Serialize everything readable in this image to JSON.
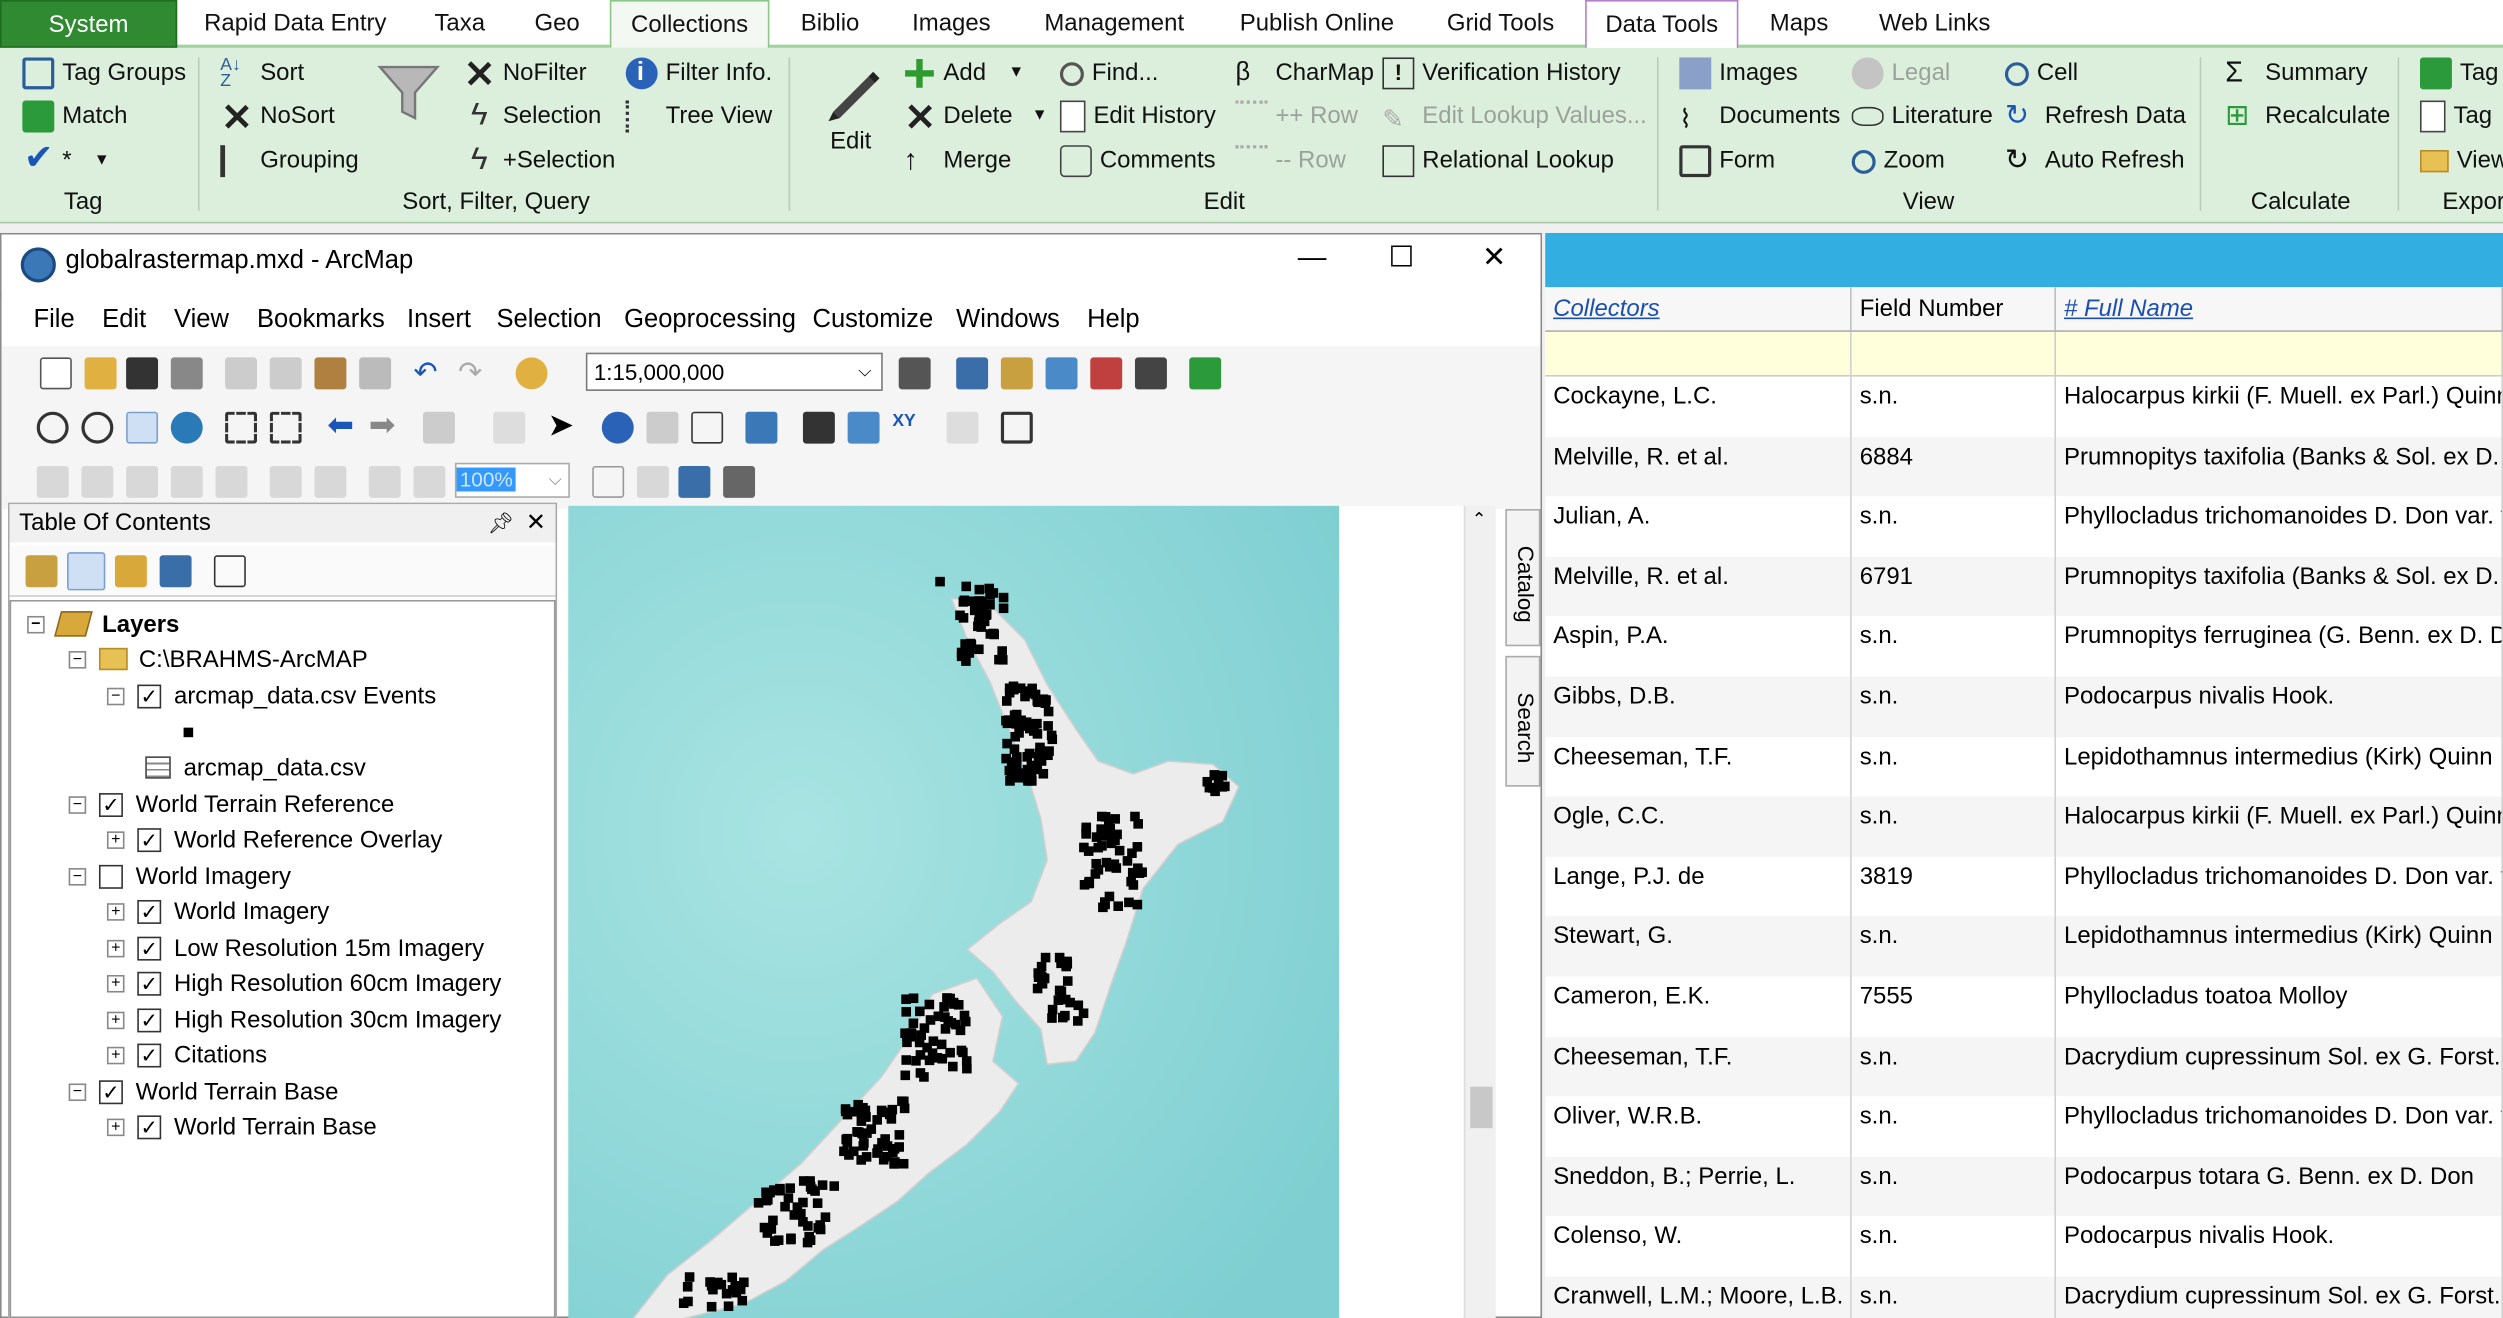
{
  "ribbon": {
    "tabs": [
      "System",
      "Rapid Data Entry",
      "Taxa",
      "Geo",
      "Collections",
      "Biblio",
      "Images",
      "Management",
      "Publish Online",
      "Grid Tools",
      "Data Tools",
      "Maps",
      "Web Links"
    ],
    "tag_group": {
      "tag_groups": "Tag Groups",
      "match": "Match",
      "check_star": "*",
      "label": "Tag"
    },
    "sort_group": {
      "sort": "Sort",
      "nosort": "NoSort",
      "grouping": "Grouping",
      "nofilter": "NoFilter",
      "selection": "Selection",
      "plus_selection": "+Selection",
      "filter_info": "Filter Info.",
      "tree_view": "Tree View",
      "label": "Sort, Filter, Query"
    },
    "edit_group": {
      "edit": "Edit",
      "add": "Add",
      "delete": "Delete",
      "merge": "Merge",
      "find": "Find...",
      "edit_history": "Edit History",
      "comments": "Comments",
      "charmap": "CharMap",
      "add_row": "++ Row",
      "remove_row": "-- Row",
      "verification_history": "Verification History",
      "edit_lookup_values": "Edit Lookup Values...",
      "relational_lookup": "Relational Lookup",
      "label": "Edit"
    },
    "view_group": {
      "images": "Images",
      "documents": "Documents",
      "form": "Form",
      "legal": "Legal",
      "literature": "Literature",
      "zoom": "Zoom",
      "cell": "Cell",
      "refresh_data": "Refresh Data",
      "auto_refresh": "Auto Refresh",
      "label": "View"
    },
    "calc_group": {
      "summary": "Summary",
      "recalculate": "Recalculate",
      "label": "Calculate"
    },
    "export_group": {
      "tag1": "Tag",
      "tag2": "Tag",
      "view": "View",
      "label": "Expor"
    }
  },
  "arcmap": {
    "title": "globalrastermap.mxd - ArcMap",
    "menus": [
      "File",
      "Edit",
      "View",
      "Bookmarks",
      "Insert",
      "Selection",
      "Geoprocessing",
      "Customize",
      "Windows",
      "Help"
    ],
    "scale": "1:15,000,000",
    "zoom_field": "100%",
    "toc": {
      "title": "Table Of Contents",
      "layers": [
        {
          "label": "Layers",
          "kind": "root"
        },
        {
          "label": "C:\\BRAHMS-ArcMAP",
          "kind": "folder"
        },
        {
          "label": "arcmap_data.csv Events",
          "kind": "checked"
        },
        {
          "label": "",
          "kind": "symbol"
        },
        {
          "label": "arcmap_data.csv",
          "kind": "table"
        },
        {
          "label": "World Terrain Reference",
          "kind": "checked"
        },
        {
          "label": "World Reference Overlay",
          "kind": "checked"
        },
        {
          "label": "World Imagery",
          "kind": "unchecked"
        },
        {
          "label": "World Imagery",
          "kind": "checked"
        },
        {
          "label": "Low Resolution 15m Imagery",
          "kind": "checked"
        },
        {
          "label": "High Resolution 60cm Imagery",
          "kind": "checked"
        },
        {
          "label": "High Resolution 30cm Imagery",
          "kind": "checked"
        },
        {
          "label": "Citations",
          "kind": "checked"
        },
        {
          "label": "World Terrain Base",
          "kind": "checked"
        },
        {
          "label": "World Terrain Base",
          "kind": "checked"
        }
      ]
    },
    "side_tabs": {
      "catalog": "Catalog",
      "search": "Search"
    }
  },
  "grid": {
    "columns": [
      "Collectors",
      "Field Number",
      "# Full Name"
    ],
    "rows": [
      [
        "Cockayne, L.C.",
        "s.n.",
        "Halocarpus kirkii (F. Muell. ex Parl.) Quinn"
      ],
      [
        "Melville, R. et al.",
        "6884",
        "Prumnopitys taxifolia (Banks & Sol. ex D. D"
      ],
      [
        "Julian, A.",
        "s.n.",
        "Phyllocladus trichomanoides D. Don var. t"
      ],
      [
        "Melville, R. et al.",
        "6791",
        "Prumnopitys taxifolia (Banks & Sol. ex D. D"
      ],
      [
        "Aspin, P.A.",
        "s.n.",
        "Prumnopitys ferruginea (G. Benn. ex D. Do"
      ],
      [
        "Gibbs, D.B.",
        "s.n.",
        "Podocarpus nivalis Hook."
      ],
      [
        "Cheeseman, T.F.",
        "s.n.",
        "Lepidothamnus intermedius (Kirk) Quinn"
      ],
      [
        "Ogle, C.C.",
        "s.n.",
        "Halocarpus kirkii (F. Muell. ex Parl.) Quinn"
      ],
      [
        "Lange, P.J. de",
        "3819",
        "Phyllocladus trichomanoides D. Don var. t"
      ],
      [
        "Stewart, G.",
        "s.n.",
        "Lepidothamnus intermedius (Kirk) Quinn"
      ],
      [
        "Cameron, E.K.",
        "7555",
        "Phyllocladus toatoa Molloy"
      ],
      [
        "Cheeseman, T.F.",
        "s.n.",
        "Dacrydium cupressinum Sol. ex G. Forst."
      ],
      [
        "Oliver, W.R.B.",
        "s.n.",
        "Phyllocladus trichomanoides D. Don var. t"
      ],
      [
        "Sneddon, B.; Perrie, L.",
        "s.n.",
        "Podocarpus totara G. Benn. ex D. Don"
      ],
      [
        "Colenso, W.",
        "s.n.",
        "Podocarpus nivalis Hook."
      ],
      [
        "Cranwell, L.M.; Moore, L.B.",
        "s.n.",
        "Dacrydium cupressinum Sol. ex G. Forst."
      ]
    ]
  },
  "colors": {
    "ribbon_bg": "#dcefdc",
    "system_tab": "#2f8a31",
    "map_sea": "#8fd8d8",
    "land": "#ebebeb",
    "grid_header_bar": "#33aee0"
  }
}
